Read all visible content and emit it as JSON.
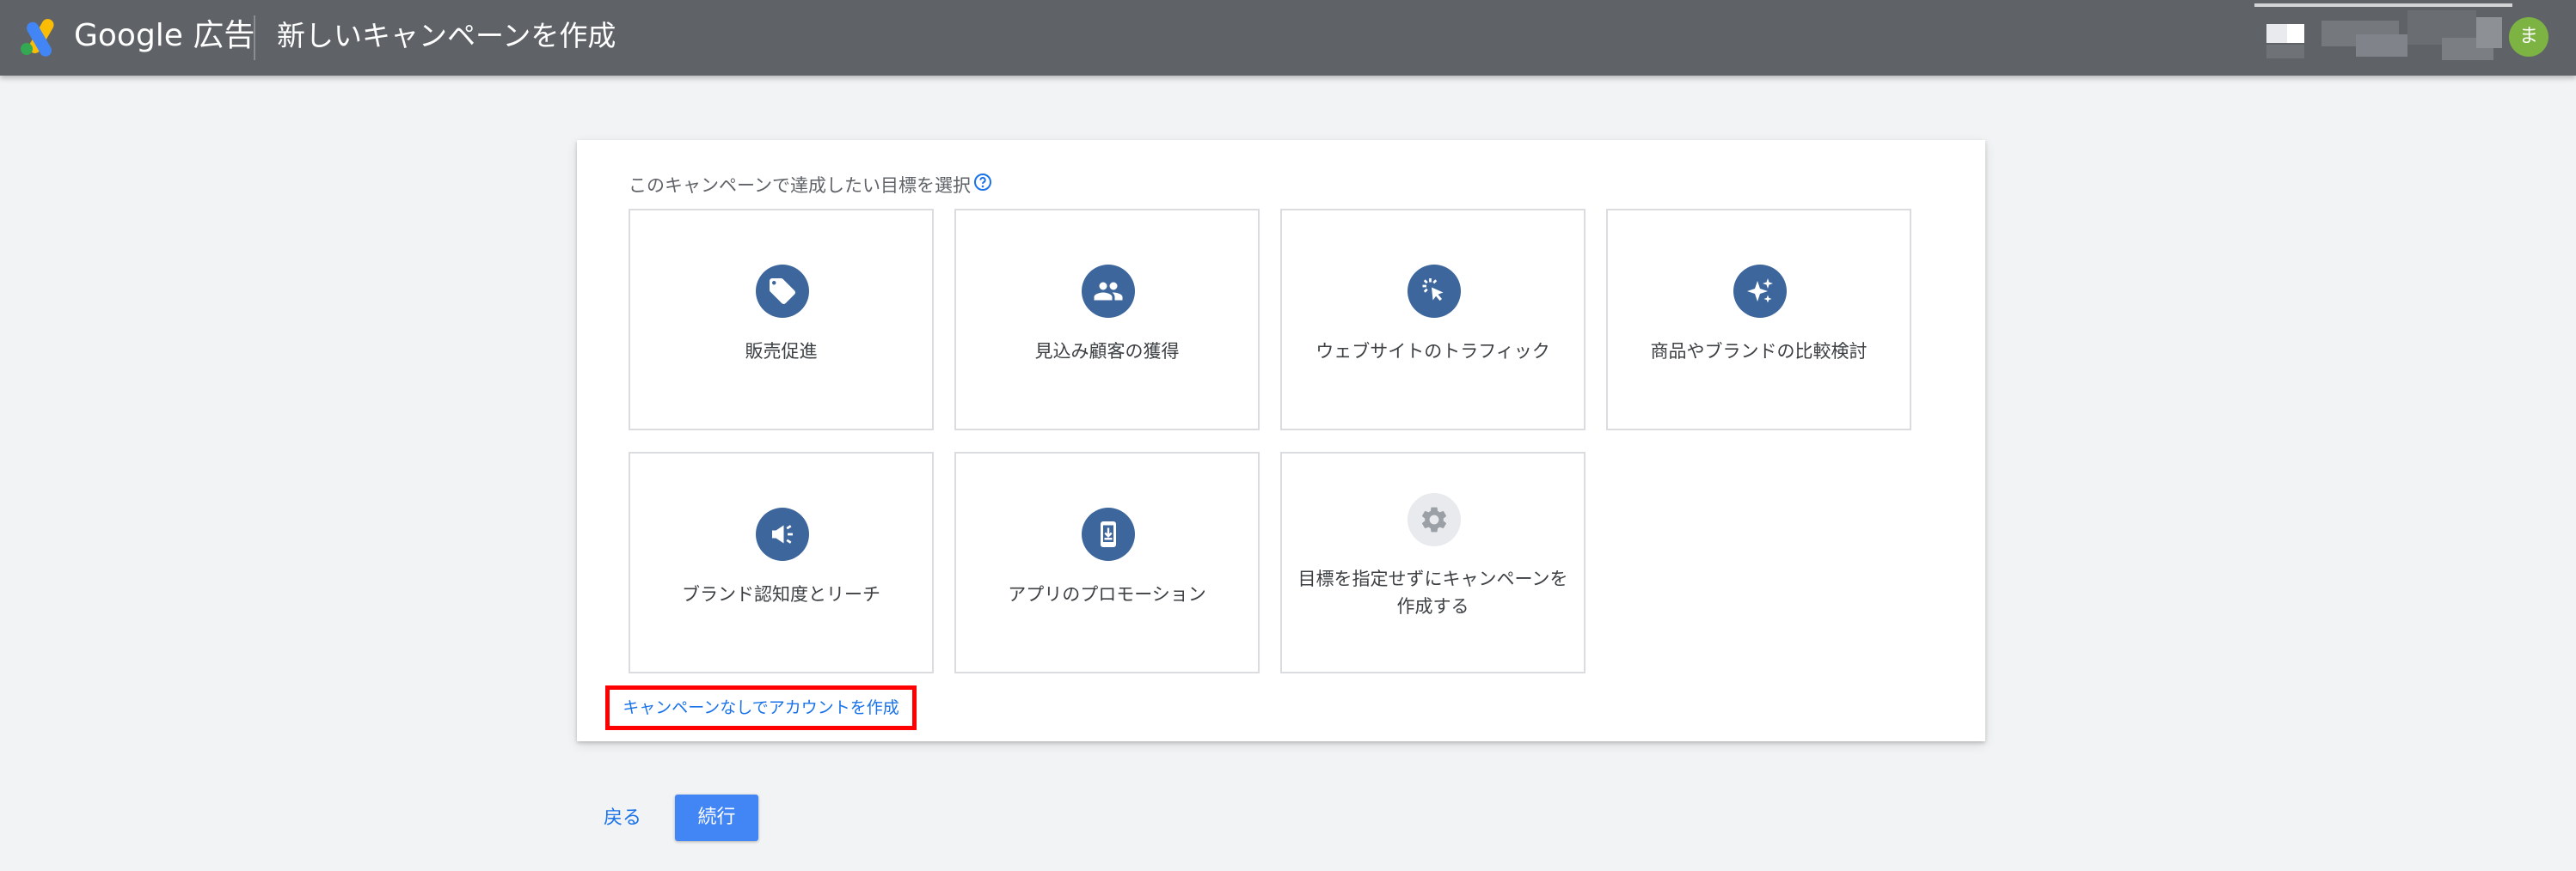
{
  "header": {
    "brand": "Google 広告",
    "page_title": "新しいキャンペーンを作成",
    "avatar_initial": "ま"
  },
  "card": {
    "prompt": "このキャンペーンで達成したい目標を選択",
    "goals": [
      {
        "label": "販売促進",
        "icon": "tag-icon"
      },
      {
        "label": "見込み顧客の獲得",
        "icon": "people-icon"
      },
      {
        "label": "ウェブサイトのトラフィック",
        "icon": "cursor-click-icon"
      },
      {
        "label": "商品やブランドの比較検討",
        "icon": "sparkle-icon"
      },
      {
        "label": "ブランド認知度とリーチ",
        "icon": "megaphone-icon"
      },
      {
        "label": "アプリのプロモーション",
        "icon": "phone-download-icon"
      },
      {
        "label_line1": "目標を指定せずにキャンペーンを",
        "label_line2": "作成する",
        "icon": "gear-icon"
      }
    ],
    "create_without_campaign": "キャンペーンなしでアカウントを作成"
  },
  "footer": {
    "back_label": "戻る",
    "continue_label": "続行"
  },
  "colors": {
    "topbar": "#5f6368",
    "goal_icon_bg": "#3d669c",
    "link": "#1a73e8",
    "primary_button": "#4285f4",
    "highlight_box": "#ff0000"
  }
}
